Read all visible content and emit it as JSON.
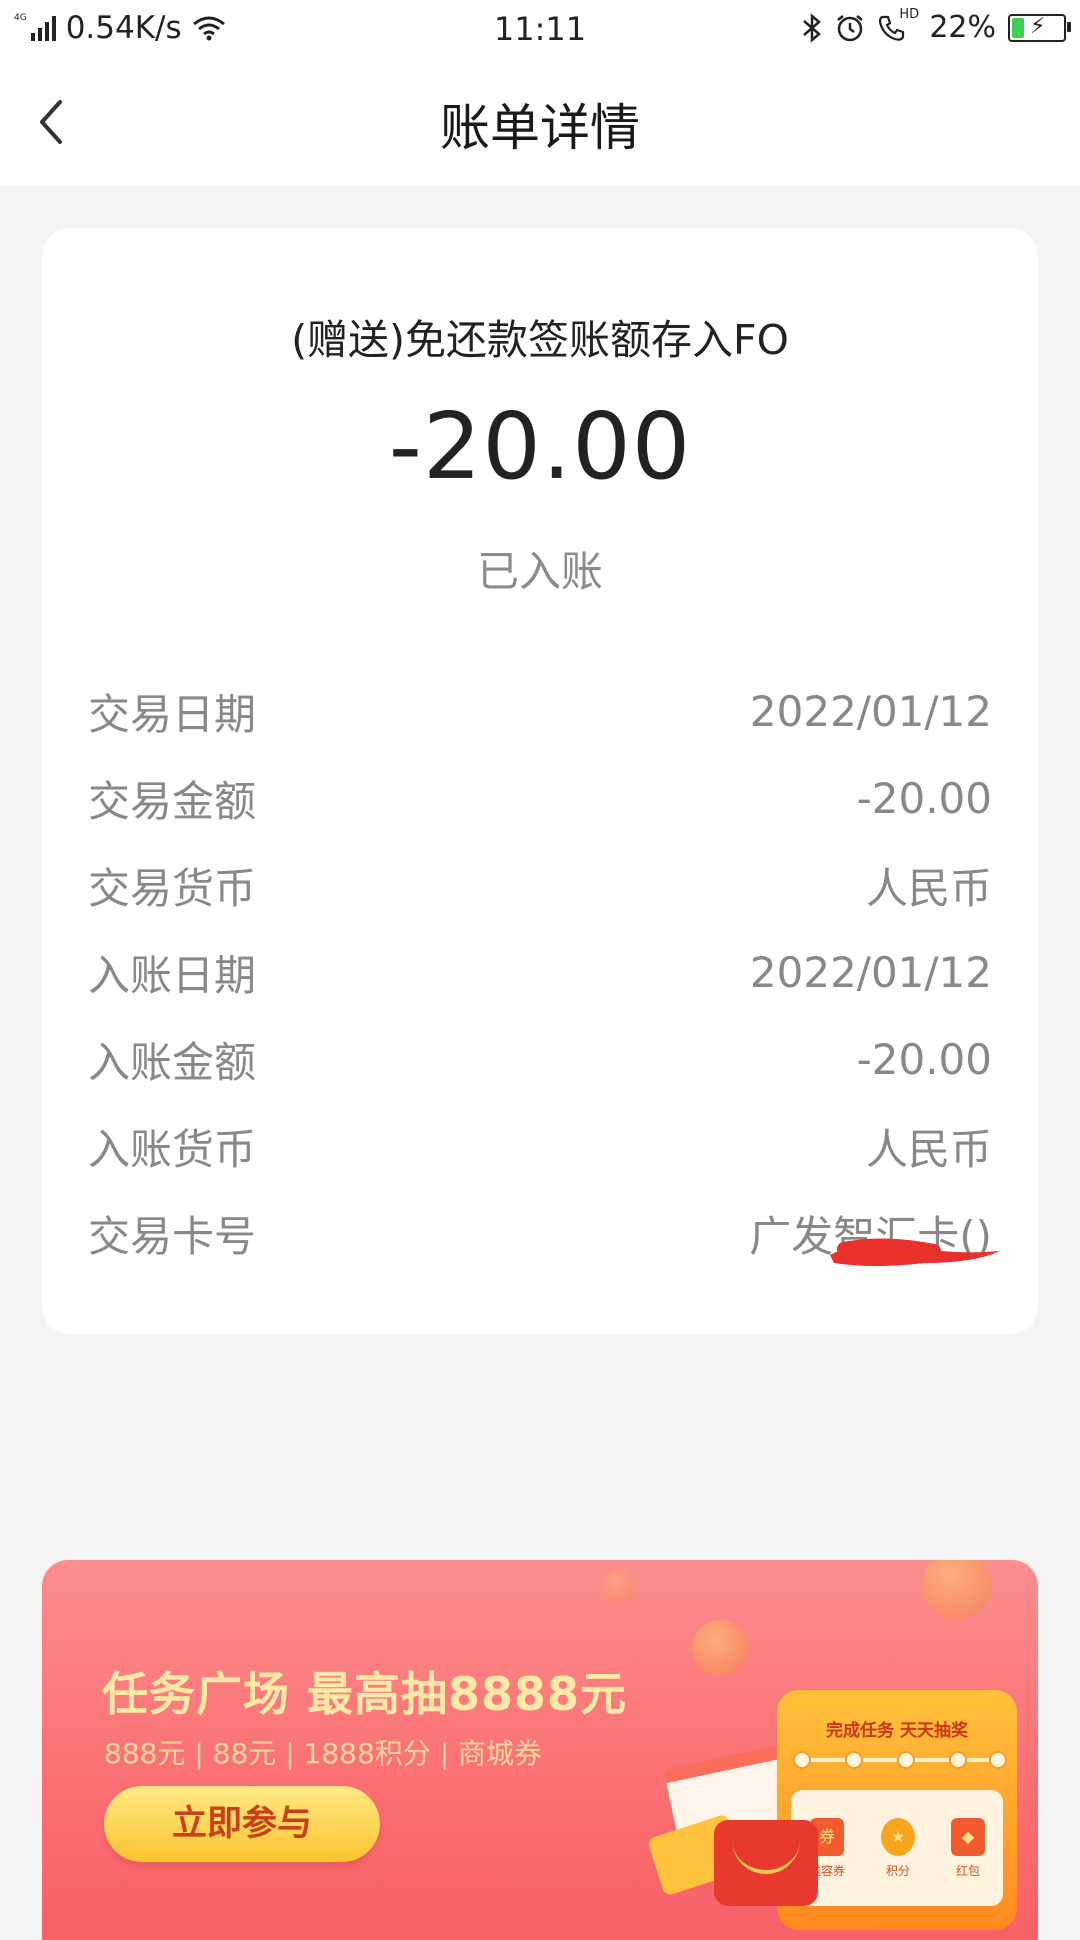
{
  "status_bar": {
    "network": "4G",
    "speed": "0.54K/s",
    "time": "11:11",
    "hd_label": "HD",
    "battery": "22%",
    "battery_level": 0.22
  },
  "nav": {
    "title": "账单详情"
  },
  "detail": {
    "description": "(赠送)免还款签账额存入FO",
    "amount": "-20.00",
    "status": "已入账",
    "rows": [
      {
        "label": "交易日期",
        "value": "2022/01/12"
      },
      {
        "label": "交易金额",
        "value": "-20.00"
      },
      {
        "label": "交易货币",
        "value": "人民币"
      },
      {
        "label": "入账日期",
        "value": "2022/01/12"
      },
      {
        "label": "入账金额",
        "value": "-20.00"
      },
      {
        "label": "入账货币",
        "value": "人民币"
      },
      {
        "label": "交易卡号",
        "value": "广发智汇卡("
      }
    ],
    "card_suffix_close": ")"
  },
  "banner": {
    "title": "任务广场 最高抽8888元",
    "subtitle": "888元 | 88元 | 1888积分 | 商城券",
    "button_label": "立即参与",
    "board_title": "完成任务 天天抽奖",
    "board_items": [
      "送容券",
      "积分",
      "红包"
    ]
  },
  "colors": {
    "accent": "#fb6f72",
    "button": "#fbc42f",
    "redaction": "#e8302c"
  }
}
